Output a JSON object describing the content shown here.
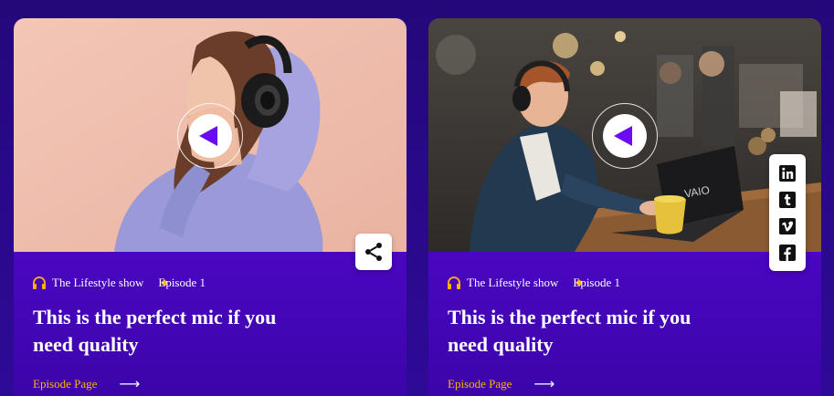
{
  "cards": [
    {
      "show_label": "The Lifestyle show",
      "episode_label": "Episode 1",
      "title": "This is the perfect mic if you need quality",
      "link_label": "Episode Page",
      "arrow": "⟶"
    },
    {
      "show_label": "The Lifestyle show",
      "episode_label": "Episode 1",
      "title": "This is the perfect mic if you need quality",
      "link_label": "Episode Page",
      "arrow": "⟶",
      "social_icons": [
        "linkedin-icon",
        "tumblr-icon",
        "vimeo-icon",
        "facebook-icon"
      ],
      "laptop_brand": "VAIO"
    }
  ],
  "colors": {
    "background": "#2a0a8f",
    "card_gradient_top": "#5f07d9",
    "accent": "#ffb300",
    "play_triangle": "#6a0bf0"
  }
}
